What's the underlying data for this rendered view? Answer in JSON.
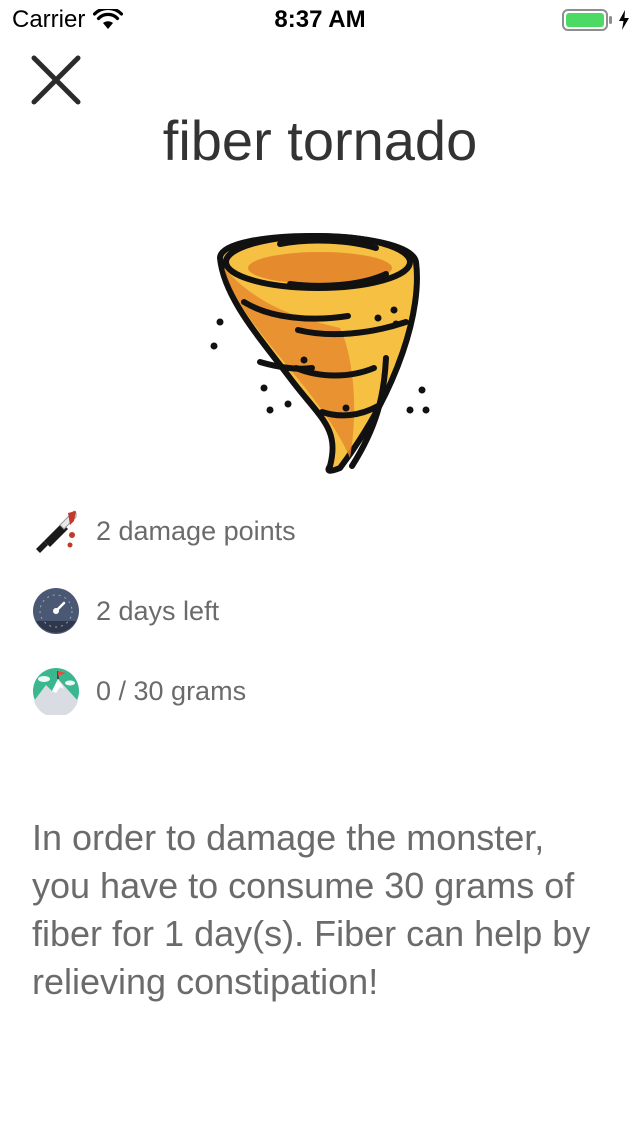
{
  "status_bar": {
    "carrier": "Carrier",
    "time": "8:37 AM"
  },
  "monster": {
    "title": "fiber tornado",
    "image_icon": "tornado-icon"
  },
  "stats": [
    {
      "icon": "dagger-icon",
      "label": "2 damage points"
    },
    {
      "icon": "clock-icon",
      "label": "2 days left"
    },
    {
      "icon": "mountain-flag-icon",
      "label": "0 / 30 grams"
    }
  ],
  "description": "In order to damage the monster, you have to consume 30 grams of fiber for 1 day(s). Fiber can help by relieving constipation!",
  "colors": {
    "tornado_light": "#f6c043",
    "tornado_dark": "#e68a2e",
    "battery": "#4cd964",
    "text": "#6b6b6b"
  }
}
